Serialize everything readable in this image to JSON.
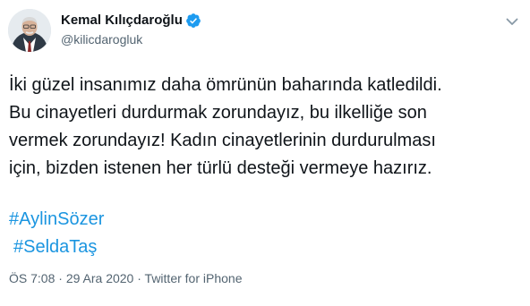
{
  "author": {
    "name": "Kemal Kılıçdaroğlu",
    "handle": "@kilicdarogluk",
    "verified": true,
    "verified_color": "#1d9bf0"
  },
  "tweet": {
    "lines": [
      "İki güzel insanımız daha ömrünün baharında katledildi.",
      "Bu cinayetleri durdurmak zorundayız, bu ilkelliğe son",
      "vermek zorundayız! Kadın cinayetlerinin durdurulması",
      "için, bizden istenen her türlü desteği vermeye hazırız."
    ],
    "hashtags": [
      "#AylinSözer",
      "#SeldaTaş"
    ]
  },
  "meta": {
    "time": "ÖS 7:08",
    "separator": " · ",
    "date": "29 Ara 2020",
    "source": "Twitter for iPhone"
  },
  "colors": {
    "link": "#1b95e0",
    "secondary_text": "#536471",
    "primary_text": "#0f1419"
  },
  "icons": {
    "verified": "verified-badge-icon",
    "more": "chevron-down-icon"
  }
}
